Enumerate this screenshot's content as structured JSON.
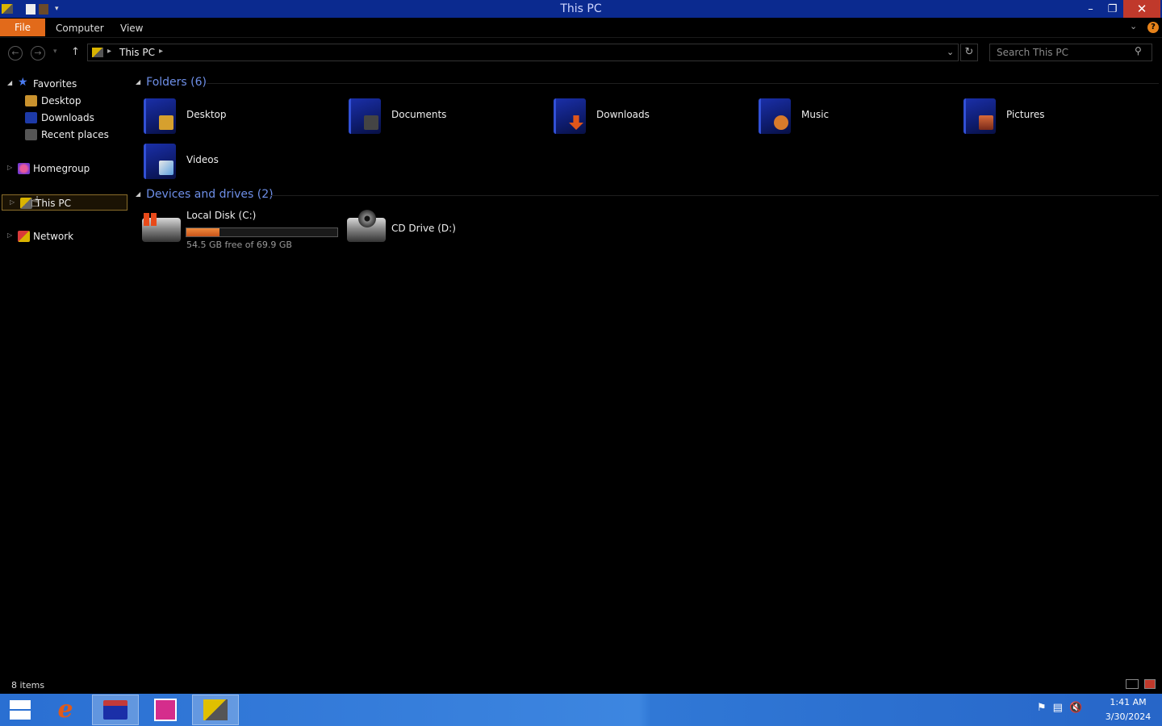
{
  "window": {
    "title": "This PC",
    "minimize": "–",
    "maximize": "❐",
    "close": "✕"
  },
  "ribbon": {
    "tabs": {
      "file": "File",
      "computer": "Computer",
      "view": "View"
    },
    "help": "?"
  },
  "address_bar": {
    "path": "This PC",
    "search_placeholder": "Search This PC"
  },
  "sidebar": {
    "favorites": {
      "label": "Favorites",
      "items": [
        "Desktop",
        "Downloads",
        "Recent places"
      ]
    },
    "homegroup": "Homegroup",
    "this_pc": "This PC",
    "network": "Network"
  },
  "content": {
    "folders_header": "Folders (6)",
    "folders": [
      "Desktop",
      "Documents",
      "Downloads",
      "Music",
      "Pictures",
      "Videos"
    ],
    "devices_header": "Devices and drives (2)",
    "drives": [
      {
        "name": "Local Disk (C:)",
        "free_text": "54.5 GB free of 69.9 GB",
        "used_fraction": 0.22
      },
      {
        "name": "CD Drive (D:)"
      }
    ]
  },
  "status_bar": {
    "text": "8 items"
  },
  "taskbar": {
    "time": "1:41 AM",
    "date": "3/30/2024"
  },
  "colors": {
    "titlebar": "#0b2a8f",
    "file_tab": "#e26a1a",
    "group_header": "#6e8fe8",
    "taskbar": "#3078d6",
    "close_button": "#c0392b"
  },
  "icons": [
    "back-arrow-icon",
    "forward-arrow-icon",
    "up-arrow-icon",
    "refresh-icon",
    "search-icon",
    "help-icon",
    "star-icon",
    "folder-icon",
    "drive-icon",
    "cd-drive-icon",
    "windows-logo-icon"
  ]
}
